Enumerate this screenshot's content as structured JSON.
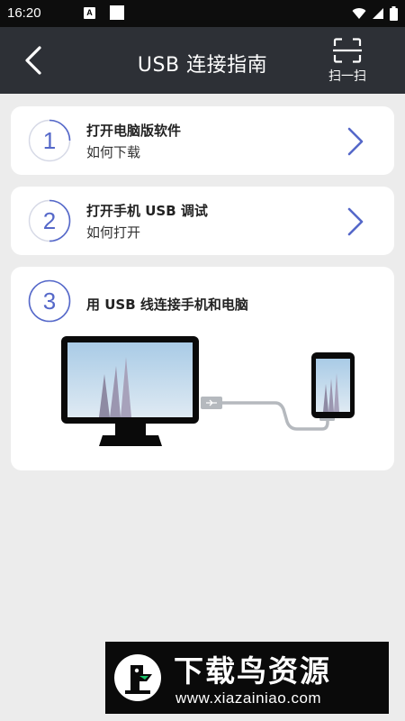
{
  "status_bar": {
    "time": "16:20",
    "notification_letter": "A",
    "icons": [
      "wifi-icon",
      "signal-icon",
      "battery-icon"
    ]
  },
  "app_bar": {
    "title": "USB 连接指南",
    "back_icon": "chevron-left-icon",
    "scan_label": "扫一扫",
    "scan_icon": "scan-frame-icon"
  },
  "steps": [
    {
      "number": "1",
      "title": "打开电脑版软件",
      "subtitle": "如何下载"
    },
    {
      "number": "2",
      "title": "打开手机 USB 调试",
      "subtitle": "如何打开"
    },
    {
      "number": "3",
      "title": "用 USB 线连接手机和电脑"
    }
  ],
  "colors": {
    "app_bar_bg": "#2d3036",
    "accent": "#5568c9",
    "page_bg": "#ececec",
    "card_bg": "#ffffff"
  },
  "watermark": {
    "name": "下载鸟资源",
    "url": "www.xiazainiao.com"
  }
}
